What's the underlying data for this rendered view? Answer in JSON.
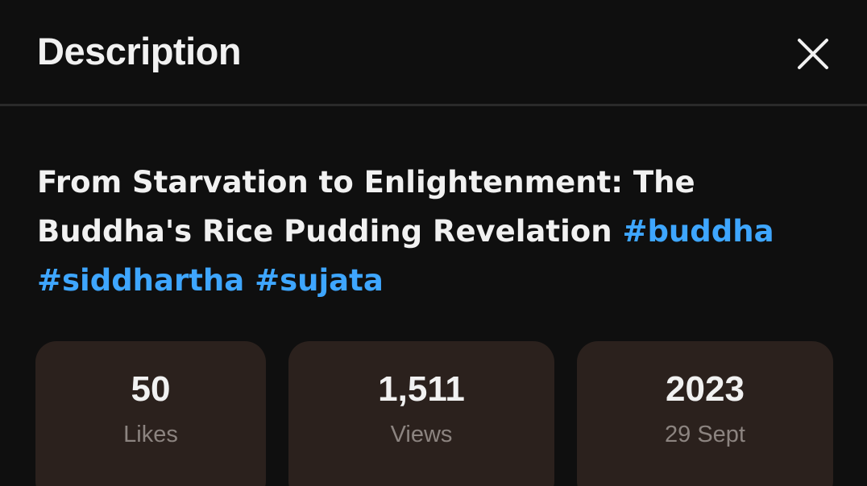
{
  "header": {
    "title": "Description",
    "close_icon": "close-icon"
  },
  "video": {
    "title_text": "From Starvation to Enlightenment: The Buddha's Rice Pudding Revelation",
    "hashtags": [
      "#buddha",
      "#siddhartha",
      "#sujata"
    ]
  },
  "stats": {
    "likes": {
      "value": "50",
      "label": "Likes"
    },
    "views": {
      "value": "1,511",
      "label": "Views"
    },
    "date": {
      "value": "2023",
      "label": "29 Sept"
    }
  },
  "colors": {
    "background": "#0f0f0f",
    "text": "#f1f1f1",
    "hashtag": "#3ea6ff",
    "card": "#2b211d",
    "muted": "#8c8480"
  }
}
